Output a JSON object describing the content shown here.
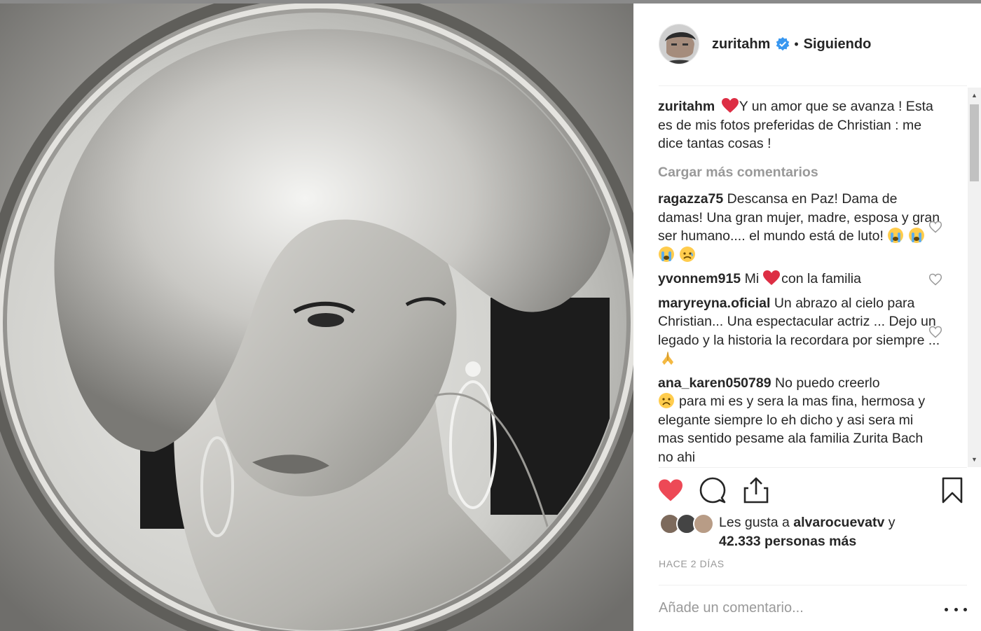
{
  "post": {
    "author": "zuritahm",
    "follow_status": "Siguiendo",
    "separator": "•"
  },
  "caption": {
    "username": "zuritahm",
    "text": "Y un amor que se avanza ! Esta es de mis fotos preferidas de Christian : me dice tantas cosas !"
  },
  "load_more_label": "Cargar más comentarios",
  "comments": [
    {
      "username": "ragazza75",
      "text": "Descansa en Paz! Dama de damas! Una gran mujer, madre, esposa y gran ser humano.... el mundo está de luto!"
    },
    {
      "username": "yvonnem915",
      "text_before": "Mi",
      "text_after": "con la familia"
    },
    {
      "username": "maryreyna.oficial",
      "text": "Un abrazo al cielo para Christian... Una espectacular actriz ... Dejo un legado y la historia la recordara por siempre ..."
    },
    {
      "username": "ana_karen050789",
      "text": "No puedo creerlo",
      "text2": "para mi es y sera la mas fina, hermosa y elegante siempre lo eh dicho y asi sera mi mas sentido pesame ala familia Zurita Bach no ahi"
    }
  ],
  "likes": {
    "prefix": "Les gusta a",
    "user": "alvarocuevatv",
    "conjunction": "y",
    "count_text": "42.333 personas más"
  },
  "timestamp": "HACE 2 DÍAS",
  "comment_input": {
    "placeholder": "Añade un comentario..."
  },
  "colors": {
    "liked_heart": "#ed4956",
    "verified_badge": "#3897f0",
    "muted_text": "#999999",
    "primary_text": "#262626"
  }
}
